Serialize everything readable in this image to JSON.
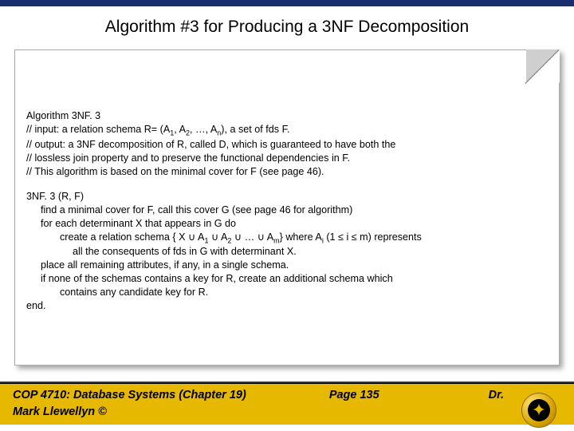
{
  "title": "Algorithm #3 for Producing a 3NF Decomposition",
  "header_block": {
    "l1": "Algorithm 3NF. 3",
    "l2_a": "// input: a relation schema R= (A",
    "l2_b": ", A",
    "l2_c": ", …, A",
    "l2_d": "),   a set of fds F.",
    "s1": "1",
    "s2": "2",
    "sn": "n",
    "l3": "// output:  a 3NF decomposition of R, called D, which is guaranteed to have both the",
    "l4": "//              lossless join property and to preserve the functional dependencies in F.",
    "l5": "//  This algorithm is based on the minimal cover for F (see page 46)."
  },
  "algo": {
    "a1": "3NF. 3 (R, F)",
    "a2": "find a minimal cover for F, call this cover G (see page 46 for algorithm)",
    "a3": "for each determinant X that appears in G do",
    "a4_a": "create a relation schema { X ∪ A",
    "a4_b": " ∪ A",
    "a4_c": " ∪ … ∪ A",
    "a4_d": "} where A",
    "a4_e": " (1 ≤ i ≤ m) represents",
    "s1": "1",
    "s2": "2",
    "sm": "m",
    "si": "i",
    "a5": "all the consequents of fds in G with determinant X.",
    "a6": "place all remaining attributes, if any, in a single schema.",
    "a7": "if none of the schemas  contains a key for R, create an additional schema which",
    "a8": "contains any candidate key for R.",
    "a9": "end."
  },
  "footer": {
    "course": "COP 4710: Database Systems  (Chapter 19)",
    "page": "Page 135",
    "instructor": "Dr.",
    "author": "Mark Llewellyn ©"
  }
}
